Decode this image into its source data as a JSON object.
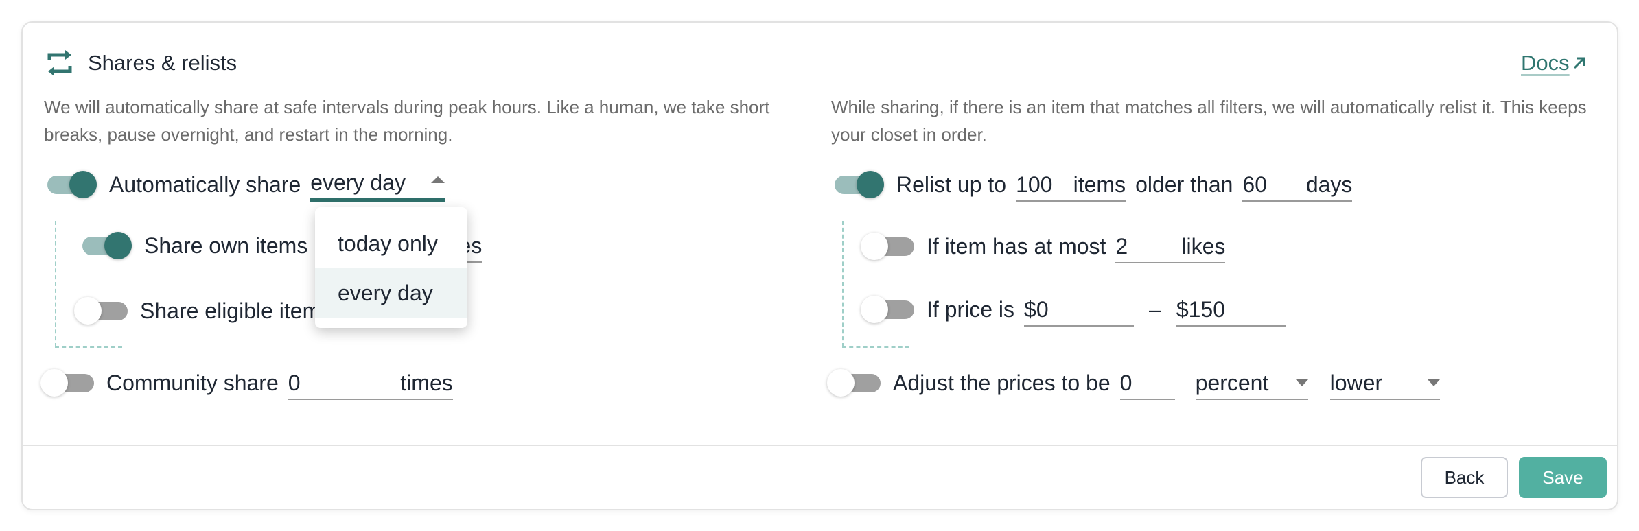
{
  "header": {
    "icon": "repeat-icon",
    "title": "Shares & relists",
    "docs_link": "Docs",
    "docs_icon": "external-link-arrow-icon"
  },
  "accent_color": "#327570",
  "primary_button_color": "#52b0a1",
  "shares": {
    "description": "We will automatically share at safe intervals during peak hours. Like a human, we take short breaks, pause overnight, and restart in the morning.",
    "auto_share": {
      "enabled": true,
      "label": "Automatically share",
      "frequency_value": "every day",
      "dropdown_open": true,
      "options": [
        "today only",
        "every day"
      ],
      "selected_option": "every day"
    },
    "share_own_items": {
      "enabled": true,
      "label": "Share own items",
      "suffix": "times"
    },
    "share_eligible_items": {
      "enabled": false,
      "label": "Share eligible items to parties"
    },
    "community_share": {
      "enabled": false,
      "label": "Community share",
      "value": "0",
      "suffix": "times"
    }
  },
  "relists": {
    "description": "While sharing, if there is an item that matches all filters, we will automatically relist it. This keeps your closet in order.",
    "relist": {
      "enabled": true,
      "label": "Relist up to",
      "count_value": "100",
      "count_suffix": "items",
      "older_label": "older than",
      "days_value": "60",
      "days_suffix": "days"
    },
    "likes_filter": {
      "enabled": false,
      "label": "If item has at most",
      "value": "2",
      "suffix": "likes"
    },
    "price_filter": {
      "enabled": false,
      "label": "If price is",
      "min_value": "$0",
      "separator": "–",
      "max_value": "$150"
    },
    "adjust_price": {
      "enabled": false,
      "label": "Adjust the prices to be",
      "value": "0",
      "unit_value": "percent",
      "direction_value": "lower"
    }
  },
  "footer": {
    "back_label": "Back",
    "save_label": "Save"
  }
}
